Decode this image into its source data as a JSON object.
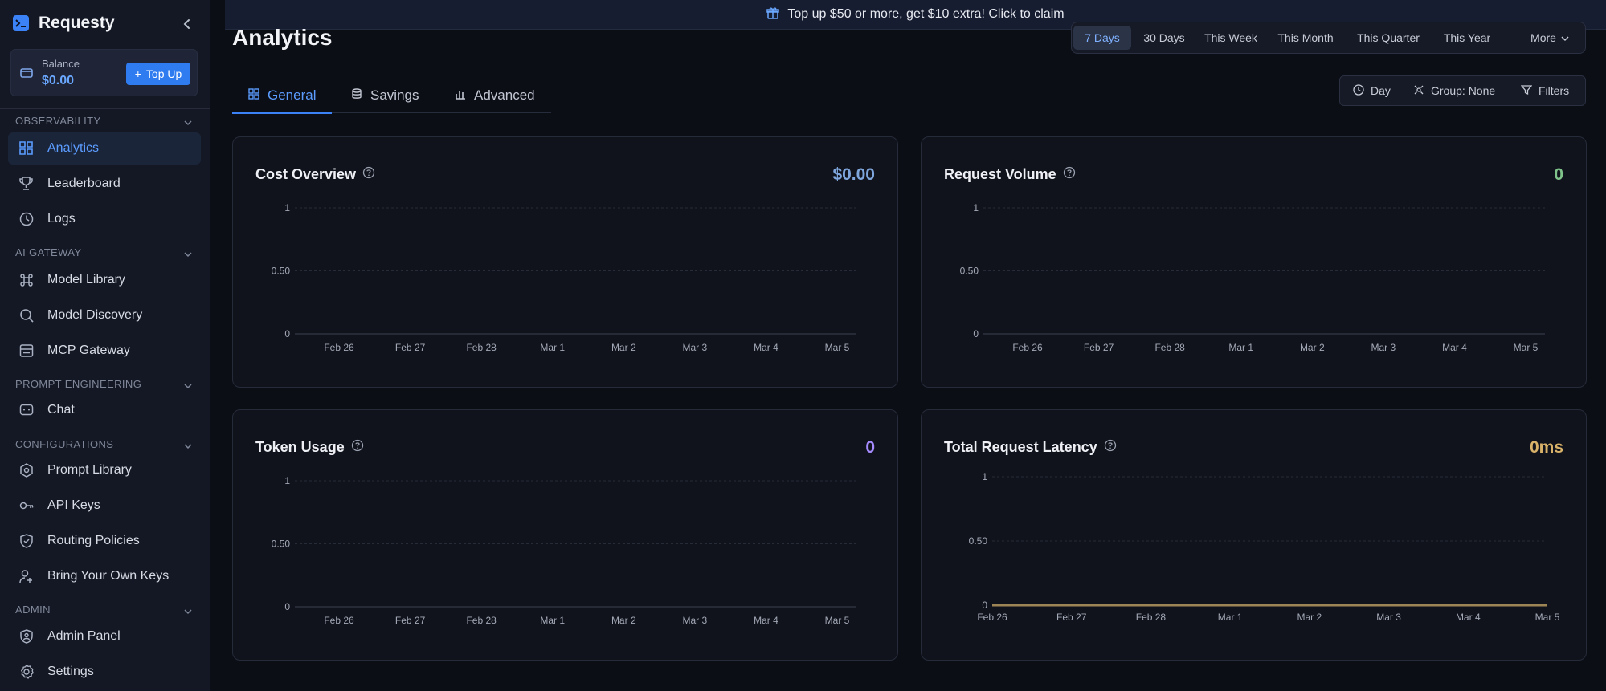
{
  "app": {
    "name": "Requesty"
  },
  "balance": {
    "label": "Balance",
    "value": "$0.00",
    "topup_label": "Top Up"
  },
  "sidebar": {
    "sections": [
      {
        "title": "OBSERVABILITY",
        "items": [
          {
            "label": "Analytics",
            "icon": "grid-icon",
            "active": true
          },
          {
            "label": "Leaderboard",
            "icon": "trophy-icon"
          },
          {
            "label": "Logs",
            "icon": "history-icon"
          }
        ]
      },
      {
        "title": "AI GATEWAY",
        "items": [
          {
            "label": "Model Library",
            "icon": "command-icon"
          },
          {
            "label": "Model Discovery",
            "icon": "search-icon"
          },
          {
            "label": "MCP Gateway",
            "icon": "server-icon"
          }
        ]
      },
      {
        "title": "PROMPT ENGINEERING",
        "items": [
          {
            "label": "Chat",
            "icon": "chat-icon"
          }
        ]
      },
      {
        "title": "CONFIGURATIONS",
        "items": [
          {
            "label": "Prompt Library",
            "icon": "hexagon-icon"
          },
          {
            "label": "API Keys",
            "icon": "key-icon"
          },
          {
            "label": "Routing Policies",
            "icon": "shield-icon"
          },
          {
            "label": "Bring Your Own Keys",
            "icon": "user-key-icon"
          }
        ]
      },
      {
        "title": "ADMIN",
        "items": [
          {
            "label": "Admin Panel",
            "icon": "admin-shield-icon"
          },
          {
            "label": "Settings",
            "icon": "gear-icon"
          }
        ]
      }
    ]
  },
  "banner": {
    "text": "Top up $50 or more, get $10 extra! Click to claim"
  },
  "page": {
    "title": "Analytics"
  },
  "date_range": {
    "options": [
      "7 Days",
      "30 Days",
      "This Week",
      "This Month",
      "This Quarter",
      "This Year",
      "More"
    ],
    "selected": "7 Days"
  },
  "tabs": [
    {
      "label": "General",
      "active": true
    },
    {
      "label": "Savings"
    },
    {
      "label": "Advanced"
    }
  ],
  "filters": {
    "interval": "Day",
    "group": "Group: None",
    "filters": "Filters"
  },
  "colors": {
    "accent": "#3b82f6",
    "cost": "#7ea6dd",
    "requests": "#7fc28a",
    "tokens": "#a58bff",
    "latency": "#d9b26a"
  },
  "cards": [
    {
      "title": "Cost Overview",
      "value": "$0.00"
    },
    {
      "title": "Request Volume",
      "value": "0"
    },
    {
      "title": "Token Usage",
      "value": "0"
    },
    {
      "title": "Total Request Latency",
      "value": "0ms"
    }
  ],
  "chart_data": [
    {
      "type": "line",
      "x": [
        "Feb 26",
        "Feb 27",
        "Feb 28",
        "Mar 1",
        "Mar 2",
        "Mar 3",
        "Mar 4",
        "Mar 5"
      ],
      "series": [
        {
          "values": [
            0,
            0,
            0,
            0,
            0,
            0,
            0,
            0
          ]
        }
      ],
      "ylim": [
        0,
        1
      ],
      "yticks": [
        "0",
        "0.50",
        "1"
      ],
      "grid": true
    },
    {
      "type": "line",
      "x": [
        "Feb 26",
        "Feb 27",
        "Feb 28",
        "Mar 1",
        "Mar 2",
        "Mar 3",
        "Mar 4",
        "Mar 5"
      ],
      "series": [
        {
          "values": [
            0,
            0,
            0,
            0,
            0,
            0,
            0,
            0
          ]
        }
      ],
      "ylim": [
        0,
        1
      ],
      "yticks": [
        "0",
        "0.50",
        "1"
      ],
      "grid": true
    },
    {
      "type": "line",
      "x": [
        "Feb 26",
        "Feb 27",
        "Feb 28",
        "Mar 1",
        "Mar 2",
        "Mar 3",
        "Mar 4",
        "Mar 5"
      ],
      "series": [
        {
          "values": [
            0,
            0,
            0,
            0,
            0,
            0,
            0,
            0
          ]
        }
      ],
      "ylim": [
        0,
        1
      ],
      "yticks": [
        "0",
        "0.50",
        "1"
      ],
      "grid": true
    },
    {
      "type": "line",
      "x": [
        "Feb 26",
        "Feb 27",
        "Feb 28",
        "Mar 1",
        "Mar 2",
        "Mar 3",
        "Mar 4",
        "Mar 5"
      ],
      "series": [
        {
          "values": [
            0,
            0,
            0,
            0,
            0,
            0,
            0,
            0
          ]
        }
      ],
      "ylim": [
        0,
        1
      ],
      "yticks": [
        "0",
        "0.50",
        "1"
      ],
      "grid": true
    }
  ]
}
